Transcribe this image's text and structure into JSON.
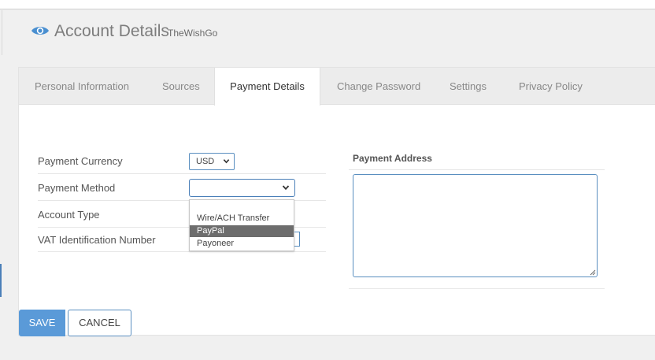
{
  "header": {
    "icon": "eye-icon",
    "title": "Account Details",
    "subtitle": "TheWishGo"
  },
  "tabs": [
    {
      "label": "Personal Information",
      "active": false
    },
    {
      "label": "Sources",
      "active": false
    },
    {
      "label": "Payment Details",
      "active": true
    },
    {
      "label": "Change Password",
      "active": false
    },
    {
      "label": "Settings",
      "active": false
    },
    {
      "label": "Privacy Policy",
      "active": false
    }
  ],
  "form": {
    "currency_label": "Payment Currency",
    "currency_value": "USD",
    "method_label": "Payment Method",
    "method_value": "",
    "account_type_label": "Account Type",
    "vat_label": "VAT Identification Number",
    "method_options": [
      "Wire/ACH Transfer",
      "PayPal",
      "Payoneer"
    ],
    "method_highlighted": "PayPal",
    "address_label": "Payment Address",
    "address_value": ""
  },
  "actions": {
    "save_label": "SAVE",
    "cancel_label": "CANCEL"
  },
  "colors": {
    "accent": "#5a9ad8",
    "border_focus": "#5a8fc0",
    "option_highlight": "#6d6d6d"
  }
}
